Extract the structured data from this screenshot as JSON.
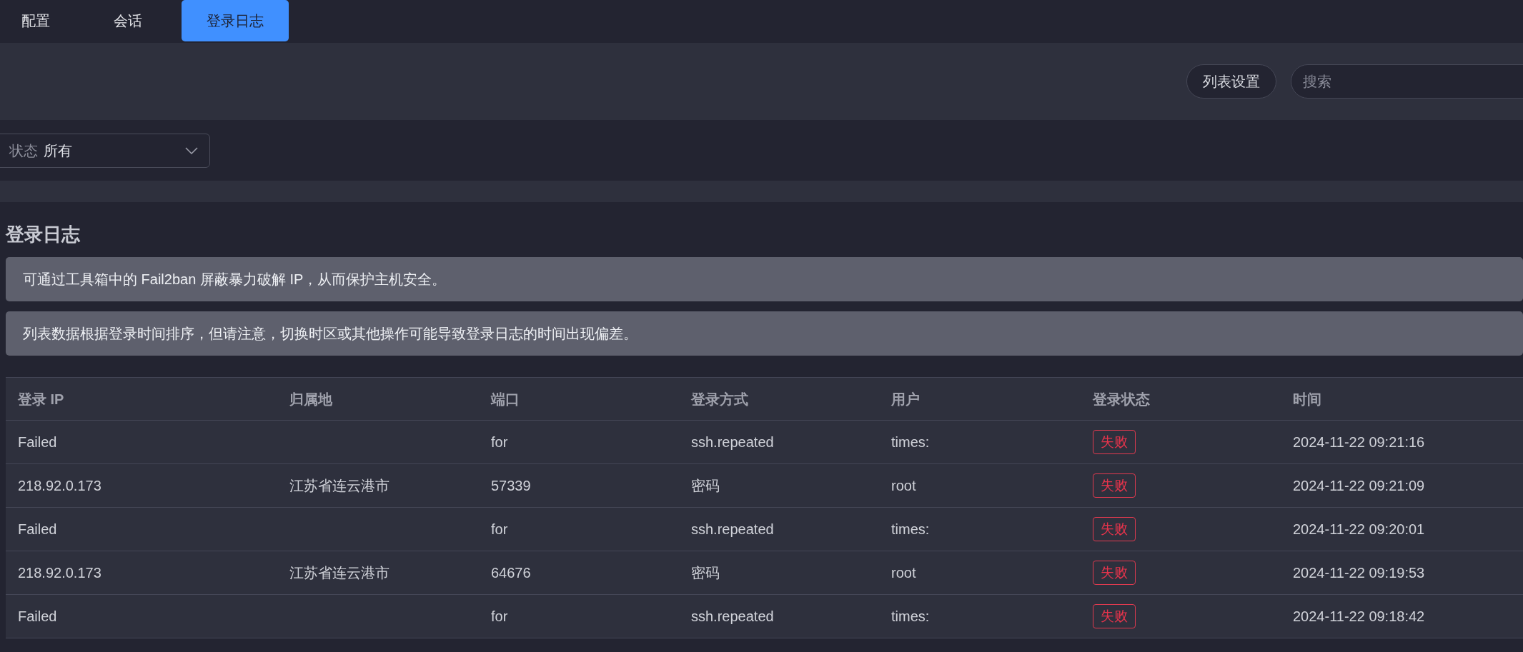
{
  "tabs": [
    {
      "label": "配置",
      "selected": false
    },
    {
      "label": "会话",
      "selected": false
    },
    {
      "label": "登录日志",
      "selected": true
    }
  ],
  "toolbar": {
    "settings_button": "列表设置",
    "search": {
      "placeholder": "搜索"
    }
  },
  "filter": {
    "label": "状态",
    "value": "所有"
  },
  "section": {
    "title": "登录日志",
    "notices": [
      "可通过工具箱中的 Fail2ban 屏蔽暴力破解 IP，从而保护主机安全。",
      "列表数据根据登录时间排序，但请注意，切换时区或其他操作可能导致登录日志的时间出现偏差。"
    ]
  },
  "table": {
    "columns": [
      "登录 IP",
      "归属地",
      "端口",
      "登录方式",
      "用户",
      "登录状态",
      "时间"
    ],
    "rows": [
      {
        "ip": "Failed",
        "location": "",
        "port": "for",
        "method": "ssh.repeated",
        "user": "times:",
        "status": {
          "text": "失败",
          "kind": "failed"
        },
        "time": "2024-11-22 09:21:16"
      },
      {
        "ip": "218.92.0.173",
        "location": "江苏省连云港市",
        "port": "57339",
        "method": "密码",
        "user": "root",
        "status": {
          "text": "失败",
          "kind": "failed"
        },
        "time": "2024-11-22 09:21:09"
      },
      {
        "ip": "Failed",
        "location": "",
        "port": "for",
        "method": "ssh.repeated",
        "user": "times:",
        "status": {
          "text": "失败",
          "kind": "failed"
        },
        "time": "2024-11-22 09:20:01"
      },
      {
        "ip": "218.92.0.173",
        "location": "江苏省连云港市",
        "port": "64676",
        "method": "密码",
        "user": "root",
        "status": {
          "text": "失败",
          "kind": "failed"
        },
        "time": "2024-11-22 09:19:53"
      },
      {
        "ip": "Failed",
        "location": "",
        "port": "for",
        "method": "ssh.repeated",
        "user": "times:",
        "status": {
          "text": "失败",
          "kind": "failed"
        },
        "time": "2024-11-22 09:18:42"
      }
    ]
  }
}
